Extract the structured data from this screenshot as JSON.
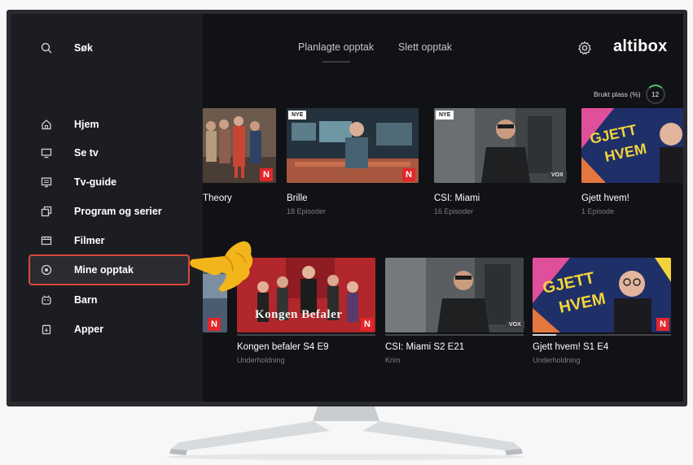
{
  "sidebar": {
    "search_label": "Søk",
    "items": [
      {
        "label": "Hjem",
        "icon": "home-icon"
      },
      {
        "label": "Se tv",
        "icon": "tv-icon"
      },
      {
        "label": "Tv-guide",
        "icon": "guide-icon"
      },
      {
        "label": "Program og serier",
        "icon": "copies-icon"
      },
      {
        "label": "Filmer",
        "icon": "film-icon"
      },
      {
        "label": "Mine opptak",
        "icon": "record-icon",
        "selected": true
      },
      {
        "label": "Barn",
        "icon": "kids-icon"
      },
      {
        "label": "Apper",
        "icon": "apps-icon"
      }
    ]
  },
  "topnav": {
    "tabs": [
      "Planlagte opptak",
      "Slett opptak"
    ]
  },
  "header": {
    "brand": "altibox",
    "storage_label": "Brukt plass (%)",
    "storage_value": "12"
  },
  "row1": [
    {
      "title": "Theory",
      "subtitle": "",
      "badge_n": true
    },
    {
      "title": "Brille",
      "subtitle": "18 Episoder",
      "badge_new": "NYE",
      "badge_n": true
    },
    {
      "title": "CSI: Miami",
      "subtitle": "16 Episoder",
      "badge_new": "NYE",
      "badge_vox": "VOX"
    },
    {
      "title": "Gjett hvem!",
      "subtitle": "1 Episode"
    }
  ],
  "row2": [
    {
      "title": "",
      "subtitle": "",
      "badge_n": true
    },
    {
      "title": "Kongen befaler S4 E9",
      "subtitle": "Underholdning",
      "thumb_text": "Kongen Befaler",
      "badge_n": true,
      "progress": 0.0
    },
    {
      "title": "CSI: Miami S2 E21",
      "subtitle": "Krim",
      "badge_vox": "VOX",
      "progress": 0.0
    },
    {
      "title": "Gjett hvem! S1 E4",
      "subtitle": "Underholdning",
      "badge_n": true,
      "progress": 0.17
    }
  ],
  "colors": {
    "accent_red": "#e3262a",
    "focus_border": "#d9483c",
    "pointer_yellow": "#f3b61a"
  }
}
